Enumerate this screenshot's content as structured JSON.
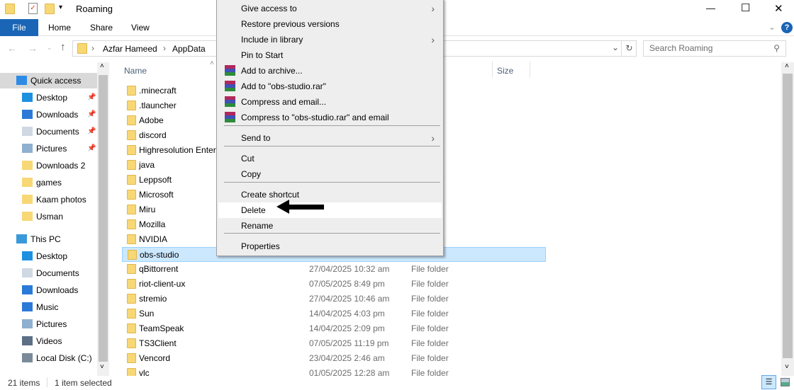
{
  "window": {
    "title": "Roaming",
    "minimize": "—",
    "maximize": "☐",
    "close": "✕"
  },
  "ribbon": {
    "tabs": [
      "File",
      "Home",
      "Share",
      "View"
    ],
    "help": "?"
  },
  "address": {
    "breadcrumb": [
      "Azfar Hameed",
      "AppData"
    ],
    "search_placeholder": "Search Roaming"
  },
  "columns": {
    "name": "Name",
    "size": "Size"
  },
  "sidebar": {
    "items": [
      {
        "label": "Quick access",
        "icon": "star-icon"
      },
      {
        "label": "Desktop",
        "icon": "desktop-icon",
        "pinned": true
      },
      {
        "label": "Downloads",
        "icon": "download-icon",
        "pinned": true
      },
      {
        "label": "Documents",
        "icon": "documents-icon",
        "pinned": true
      },
      {
        "label": "Pictures",
        "icon": "pictures-icon",
        "pinned": true
      },
      {
        "label": "Downloads 2",
        "icon": "folder-icon"
      },
      {
        "label": "games",
        "icon": "folder-icon"
      },
      {
        "label": "Kaam photos",
        "icon": "folder-icon"
      },
      {
        "label": "Usman",
        "icon": "folder-icon"
      },
      {
        "label": "This PC",
        "icon": "pc-icon"
      },
      {
        "label": "Desktop",
        "icon": "desktop-icon"
      },
      {
        "label": "Documents",
        "icon": "documents-icon"
      },
      {
        "label": "Downloads",
        "icon": "download-icon"
      },
      {
        "label": "Music",
        "icon": "music-icon"
      },
      {
        "label": "Pictures",
        "icon": "pictures-icon"
      },
      {
        "label": "Videos",
        "icon": "videos-icon"
      },
      {
        "label": "Local Disk (C:)",
        "icon": "drive-icon"
      }
    ]
  },
  "files": [
    {
      "name": ".minecraft",
      "date": "",
      "type": ""
    },
    {
      "name": ".tlauncher",
      "date": "",
      "type": ""
    },
    {
      "name": "Adobe",
      "date": "",
      "type": ""
    },
    {
      "name": "discord",
      "date": "",
      "type": ""
    },
    {
      "name": "Highresolution Enter",
      "date": "",
      "type": ""
    },
    {
      "name": "java",
      "date": "",
      "type": ""
    },
    {
      "name": "Leppsoft",
      "date": "",
      "type": ""
    },
    {
      "name": "Microsoft",
      "date": "",
      "type": ""
    },
    {
      "name": "Miru",
      "date": "",
      "type": ""
    },
    {
      "name": "Mozilla",
      "date": "",
      "type": ""
    },
    {
      "name": "NVIDIA",
      "date": "",
      "type": ""
    },
    {
      "name": "obs-studio",
      "date": "",
      "type": "",
      "selected": true
    },
    {
      "name": "qBittorrent",
      "date": "27/04/2025 10:32 am",
      "type": "File folder"
    },
    {
      "name": "riot-client-ux",
      "date": "07/05/2025 8:49 pm",
      "type": "File folder"
    },
    {
      "name": "stremio",
      "date": "27/04/2025 10:46 am",
      "type": "File folder"
    },
    {
      "name": "Sun",
      "date": "14/04/2025 4:03 pm",
      "type": "File folder"
    },
    {
      "name": "TeamSpeak",
      "date": "14/04/2025 2:09 pm",
      "type": "File folder"
    },
    {
      "name": "TS3Client",
      "date": "07/05/2025 11:19 pm",
      "type": "File folder"
    },
    {
      "name": "Vencord",
      "date": "23/04/2025 2:46 am",
      "type": "File folder"
    },
    {
      "name": "vlc",
      "date": "01/05/2025 12:28 am",
      "type": "File folder"
    }
  ],
  "context_menu": [
    {
      "label": "Give access to",
      "submenu": true
    },
    {
      "label": "Restore previous versions"
    },
    {
      "label": "Include in library",
      "submenu": true
    },
    {
      "label": "Pin to Start"
    },
    {
      "label": "Add to archive...",
      "rar": true
    },
    {
      "label": "Add to \"obs-studio.rar\"",
      "rar": true
    },
    {
      "label": "Compress and email...",
      "rar": true
    },
    {
      "label": "Compress to \"obs-studio.rar\" and email",
      "rar": true
    },
    {
      "label": "Send to",
      "submenu": true
    },
    {
      "label": "Cut"
    },
    {
      "label": "Copy"
    },
    {
      "label": "Create shortcut"
    },
    {
      "label": "Delete",
      "highlighted": true
    },
    {
      "label": "Rename"
    },
    {
      "label": "Properties"
    }
  ],
  "status": {
    "items": "21 items",
    "selected": "1 item selected"
  }
}
